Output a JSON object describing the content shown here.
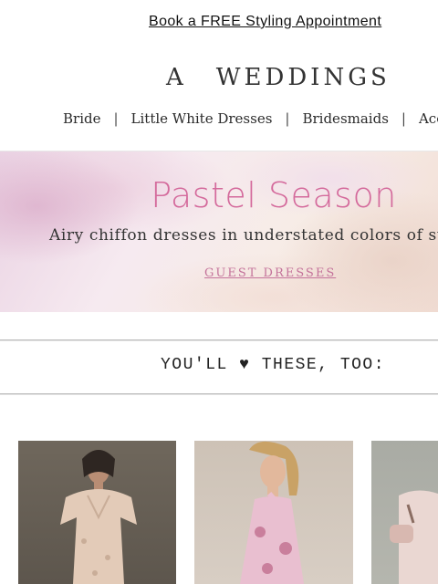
{
  "promo_bar": {
    "link_text": "Book a FREE Styling Appointment"
  },
  "brand": {
    "mark": "A",
    "name": "WEDDINGS"
  },
  "nav": {
    "items": [
      "Bride",
      "Little White Dresses",
      "Bridesmaids",
      "Acces"
    ],
    "separator": "|"
  },
  "hero": {
    "title": "Pastel Season",
    "subtitle": "Airy chiffon dresses in understated colors of su",
    "cta": "GUEST DRESSES",
    "title_color": "#d46a9c",
    "cta_color": "#c4739b"
  },
  "recommend": {
    "heading": "YOU'LL ♥ THESE, TOO:"
  },
  "products": [
    {
      "description_icon": "dress-photo",
      "dress_color": "#e3cbb8"
    },
    {
      "description_icon": "dress-photo",
      "dress_color": "#e9bfd0"
    },
    {
      "description_icon": "dress-photo",
      "dress_color": "#ead7d2"
    }
  ]
}
